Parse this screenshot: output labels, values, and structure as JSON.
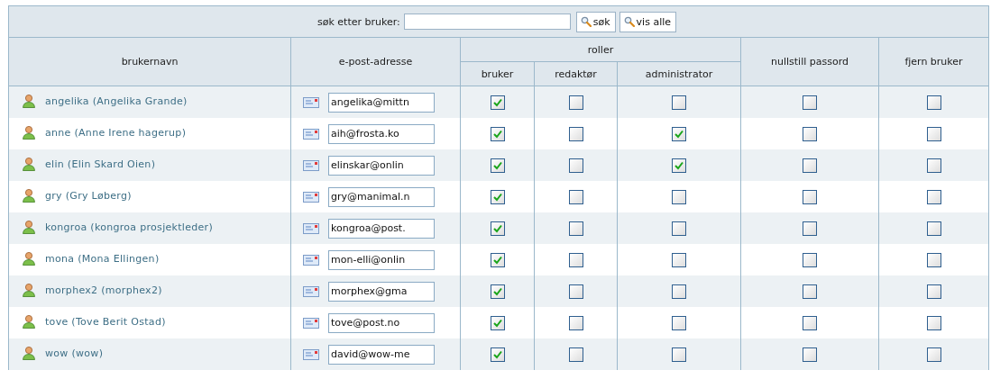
{
  "search": {
    "label": "søk etter bruker:",
    "buttons": [
      "søk",
      "vis alle"
    ]
  },
  "header": {
    "username": "brukernavn",
    "email": "e-post-adresse",
    "roles": "roller",
    "role_columns": [
      "bruker",
      "redaktør",
      "administrator"
    ],
    "reset_password": "nullstill passord",
    "remove_user": "fjern bruker"
  },
  "rows": [
    {
      "user": "angelika (Angelika Grande)",
      "email": "angelika@mittn",
      "roles": [
        true,
        false,
        false
      ],
      "reset_password": false,
      "remove_user": false
    },
    {
      "user": "anne (Anne Irene hagerup)",
      "email": "aih@frosta.ko",
      "roles": [
        true,
        false,
        true
      ],
      "reset_password": false,
      "remove_user": false
    },
    {
      "user": "elin (Elin Skard Oien)",
      "email": "elinskar@onlin",
      "roles": [
        true,
        false,
        true
      ],
      "reset_password": false,
      "remove_user": false
    },
    {
      "user": "gry (Gry Løberg)",
      "email": "gry@manimal.n",
      "roles": [
        true,
        false,
        false
      ],
      "reset_password": false,
      "remove_user": false
    },
    {
      "user": "kongroa (kongroa prosjektleder)",
      "email": "kongroa@post.",
      "roles": [
        true,
        false,
        false
      ],
      "reset_password": false,
      "remove_user": false
    },
    {
      "user": "mona (Mona Ellingen)",
      "email": "mon-elli@onlin",
      "roles": [
        true,
        false,
        false
      ],
      "reset_password": false,
      "remove_user": false
    },
    {
      "user": "morphex2 (morphex2)",
      "email": "morphex@gma",
      "roles": [
        true,
        false,
        false
      ],
      "reset_password": false,
      "remove_user": false
    },
    {
      "user": "tove (Tove Berit Ostad)",
      "email": "tove@post.no",
      "roles": [
        true,
        false,
        false
      ],
      "reset_password": false,
      "remove_user": false
    },
    {
      "user": "wow (wow)",
      "email": "david@wow-me",
      "roles": [
        true,
        false,
        false
      ],
      "reset_password": false,
      "remove_user": false
    }
  ]
}
